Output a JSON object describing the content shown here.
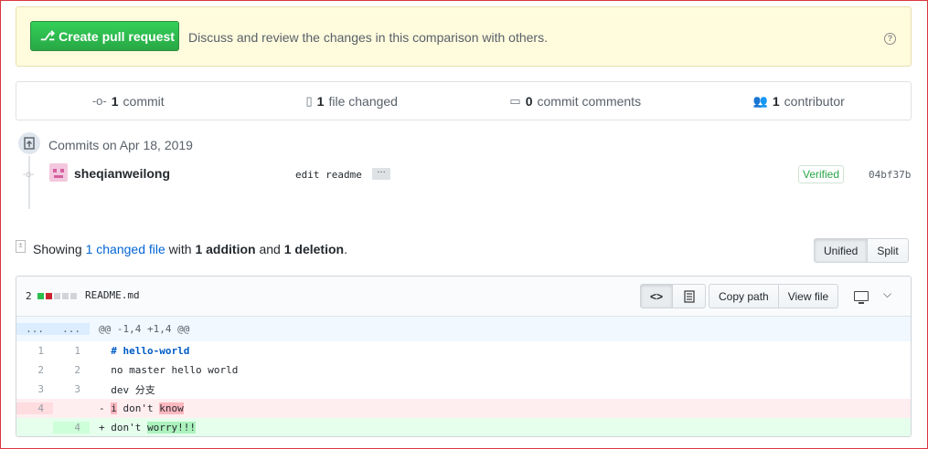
{
  "banner": {
    "button_label": "Create pull request",
    "text": "Discuss and review the changes in this comparison with others."
  },
  "stats": {
    "commits": {
      "count": "1",
      "label": "commit"
    },
    "files": {
      "count": "1",
      "label": "file changed"
    },
    "comments": {
      "count": "0",
      "label": "commit comments"
    },
    "contributors": {
      "count": "1",
      "label": "contributor"
    }
  },
  "commits": {
    "date_heading": "Commits on Apr 18, 2019",
    "items": [
      {
        "author": "sheqianweilong",
        "message": "edit readme",
        "ellipsis": "…",
        "badge": "Verified",
        "sha": "04bf37b"
      }
    ]
  },
  "toc": {
    "prefix": "Showing ",
    "link": "1 changed file",
    "middle": " with ",
    "additions": "1 addition",
    "and": " and ",
    "deletions": "1 deletion",
    "suffix": ".",
    "unified_label": "Unified",
    "split_label": "Split"
  },
  "file": {
    "change_count": "2",
    "name": "README.md",
    "copy_path_label": "Copy path",
    "view_file_label": "View file",
    "hunk": {
      "left": "...",
      "right": "...",
      "header": "@@ -1,4 +1,4 @@"
    },
    "lines": [
      {
        "old": "1",
        "new": "1",
        "marker": " ",
        "text": "# hello-world",
        "type": "ctx"
      },
      {
        "old": "2",
        "new": "2",
        "marker": " ",
        "text": "no master hello world",
        "type": "ctx"
      },
      {
        "old": "3",
        "new": "3",
        "marker": " ",
        "text": "dev 分支",
        "type": "ctx"
      },
      {
        "old": "4",
        "new": "",
        "marker": "-",
        "seg1": "i",
        "seg2": " don't ",
        "seg3": "know",
        "type": "del"
      },
      {
        "old": "",
        "new": "4",
        "marker": "+",
        "seg1": "don't ",
        "seg2": "worry!!!",
        "type": "add"
      }
    ]
  },
  "colors": {
    "green": "#28a745",
    "link": "#0366d6"
  }
}
